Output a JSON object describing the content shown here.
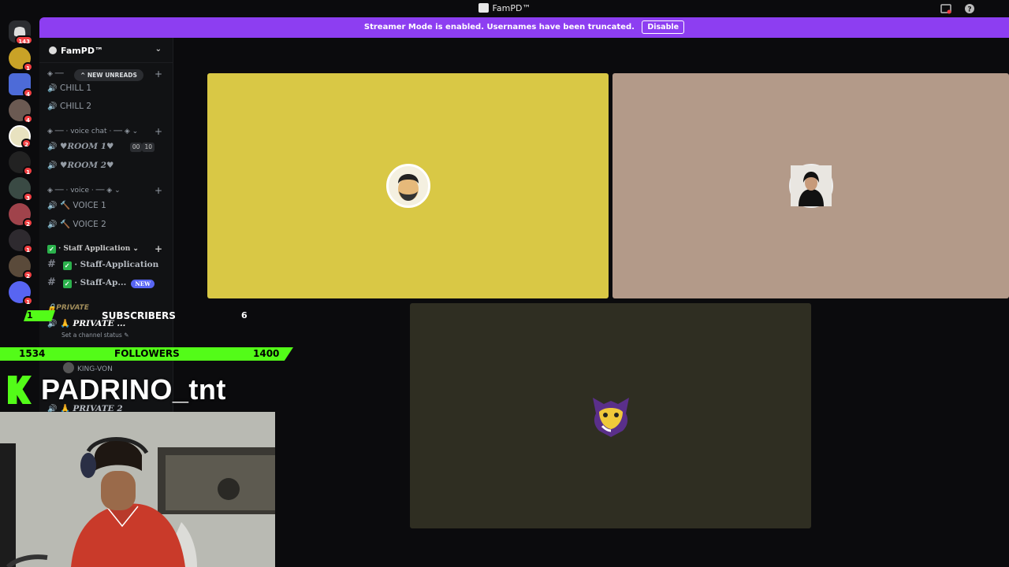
{
  "window": {
    "title": "FamPD™"
  },
  "banner": {
    "message": "Streamer Mode is enabled. Usernames have been truncated.",
    "disable_label": "Disable"
  },
  "guilds": [
    {
      "badge": "143"
    },
    {
      "badge": "1"
    },
    {
      "badge": "4"
    },
    {
      "badge": "4"
    },
    {
      "badge": "2"
    },
    {
      "badge": "1"
    },
    {
      "badge": "3"
    },
    {
      "badge": "2"
    },
    {
      "badge": "1"
    },
    {
      "badge": "2"
    },
    {
      "badge": "1"
    }
  ],
  "server": {
    "name": "FamPD™"
  },
  "new_unreads": "NEW UNREADS",
  "categories": {
    "voice_chat": "voice chat",
    "voice": "voice",
    "staff": "Staff Application",
    "private": "PRIVATE"
  },
  "channels": {
    "chill1": "CHILL 1",
    "chill2": "CHILL 2",
    "room1": "♥ROOM 1♥",
    "room1_a": "00",
    "room1_b": "10",
    "room2": "♥ROOM 2♥",
    "voice1": "VOICE 1",
    "voice2": "VOICE 2",
    "staff_app": "· Staff-Application",
    "staff_ap2": "· Staff-Ap...",
    "new": "NEW",
    "private1": "PRIVATE ...",
    "channel_status": "Set a channel status",
    "member": "KING-VON",
    "private2": "PRIVATE 2"
  },
  "overlay": {
    "subs_count": "1",
    "subs_label": "SUBSCRIBERS",
    "subs_goal": "6",
    "followers_count": "1534",
    "followers_label": "FOLLOWERS",
    "followers_goal": "1400",
    "streamer_name": "PADRINO_tnt"
  },
  "colors": {
    "accent": "#8d3ef1",
    "kick_green": "#53fc18",
    "tile_yellow": "#d9c845",
    "tile_beige": "#b39a89",
    "tile_olive": "#2f2e22"
  }
}
